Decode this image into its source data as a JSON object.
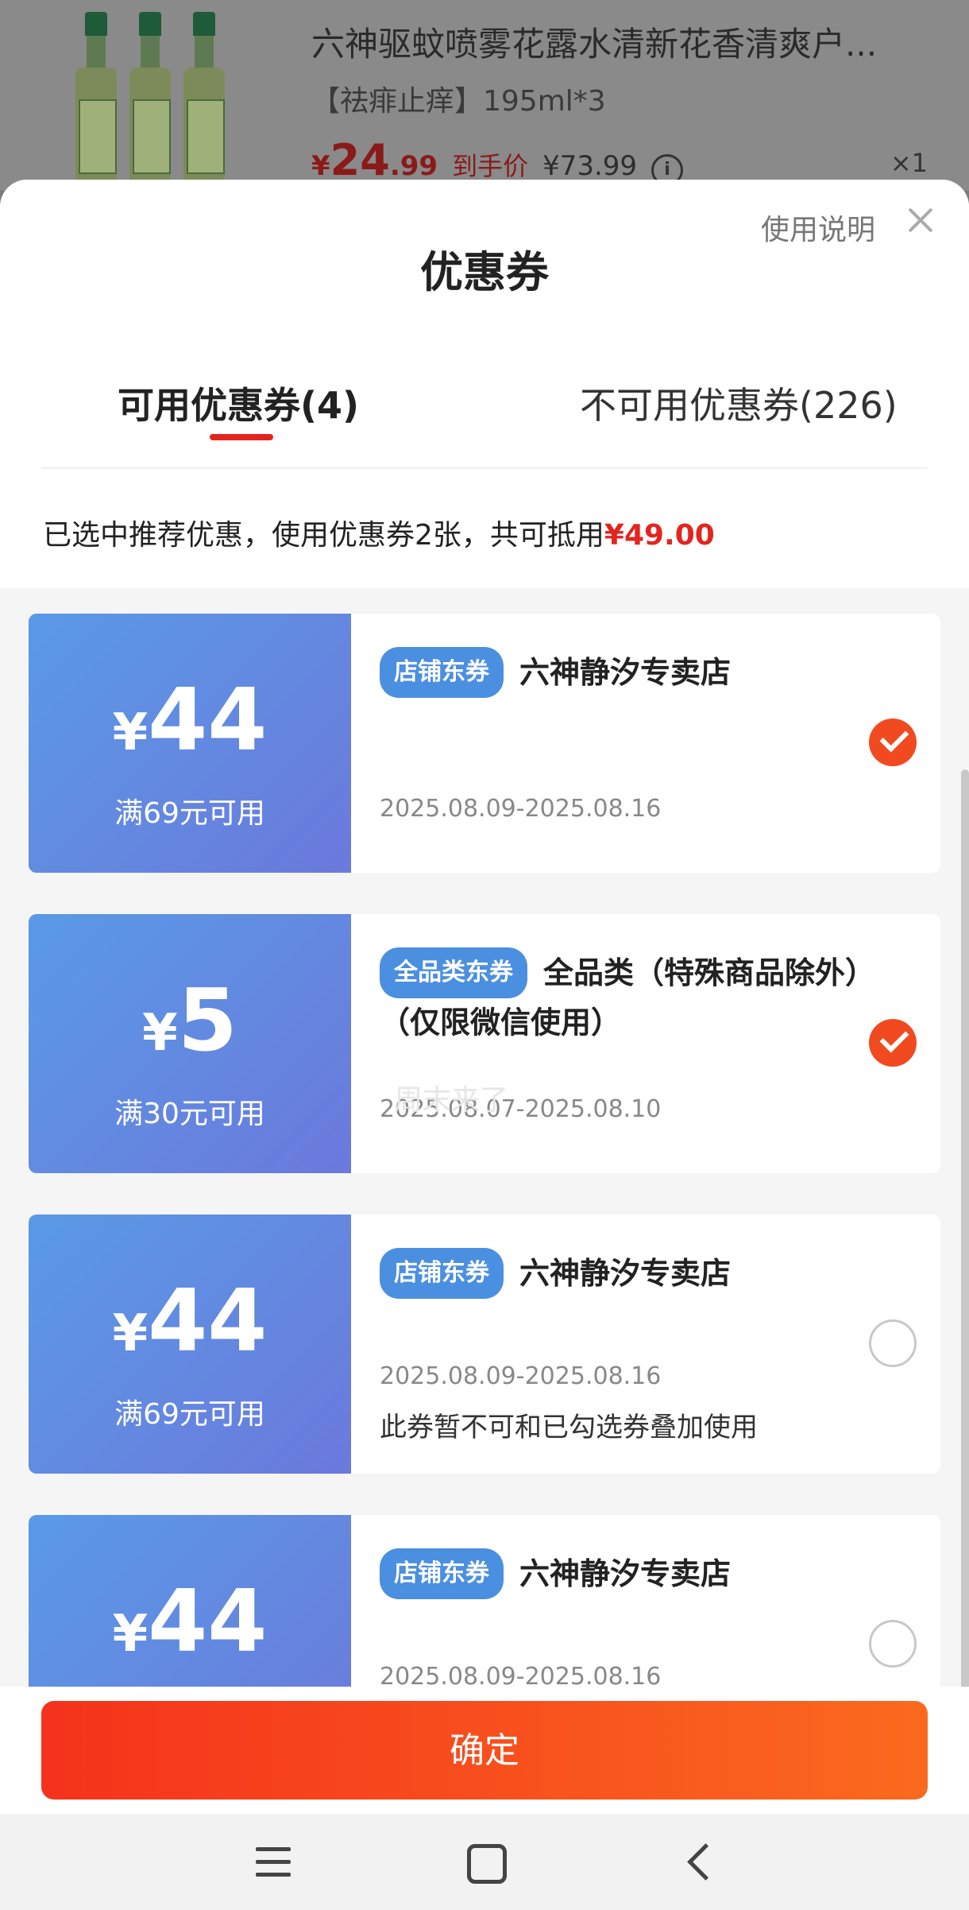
{
  "product": {
    "title": "六神驱蚊喷雾花露水清新花香清爽户...",
    "spec": "【祛痱止痒】195ml*3",
    "price_symbol": "¥",
    "price_int": "24",
    "price_dec": ".99",
    "daoshou_label": "到手价",
    "daoshou_price": "¥73.99",
    "info_icon": "i",
    "qty": "×1"
  },
  "sheet": {
    "title": "优惠券",
    "help_label": "使用说明",
    "tabs": [
      {
        "label": "可用优惠券(4)",
        "active": true
      },
      {
        "label": "不可用优惠券(226)",
        "active": false
      }
    ],
    "summary_text": "已选中推荐优惠，使用优惠券2张，共可抵用",
    "summary_amount": "¥49.00"
  },
  "coupons": [
    {
      "yen": "¥",
      "amount": "44",
      "threshold": "满69元可用",
      "badge": "店铺东券",
      "title": "六神静汐专卖店",
      "date": "2025.08.09-2025.08.16",
      "note": "",
      "selected": true
    },
    {
      "yen": "¥",
      "amount": "5",
      "threshold": "满30元可用",
      "badge": "全品类东券",
      "title": "全品类（特殊商品除外）（仅限微信使用）",
      "date": "2025.08.07-2025.08.10",
      "note": "",
      "selected": true
    },
    {
      "yen": "¥",
      "amount": "44",
      "threshold": "满69元可用",
      "badge": "店铺东券",
      "title": "六神静汐专卖店",
      "date": "2025.08.09-2025.08.16",
      "note": "此券暂不可和已勾选券叠加使用",
      "selected": false
    },
    {
      "yen": "¥",
      "amount": "44",
      "threshold": "",
      "badge": "店铺东券",
      "title": "六神静汐专卖店",
      "date": "2025.08.09-2025.08.16",
      "note": "",
      "selected": false
    }
  ],
  "watermark": "周末来了",
  "confirm_label": "确定",
  "colors": {
    "accent": "#e4251f",
    "coupon_blue": "#5a9ae6",
    "check": "#f24a20"
  }
}
